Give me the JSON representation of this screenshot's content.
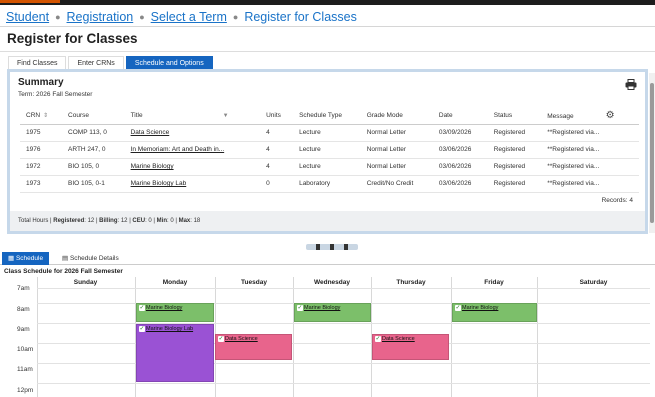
{
  "breadcrumb": {
    "student": "Student",
    "registration": "Registration",
    "select_term": "Select a Term",
    "current": "Register for Classes"
  },
  "page_title": "Register for Classes",
  "tabs": [
    "Find Classes",
    "Enter CRNs",
    "Schedule and Options"
  ],
  "summary": {
    "title": "Summary",
    "term": "Term:  2026 Fall Semester",
    "columns": [
      "CRN",
      "Course",
      "Title",
      "Units",
      "Schedule Type",
      "Grade Mode",
      "Date",
      "Status",
      "Message"
    ],
    "rows": [
      [
        "1975",
        "COMP 113, 0",
        "Data Science",
        "4",
        "Lecture",
        "Normal Letter",
        "03/09/2026",
        "Registered",
        "**Registered via..."
      ],
      [
        "1976",
        "ARTH 247, 0",
        "In Memoriam: Art and Death in...",
        "4",
        "Lecture",
        "Normal Letter",
        "03/06/2026",
        "Registered",
        "**Registered via..."
      ],
      [
        "1972",
        "BIO 105, 0",
        "Marine Biology",
        "4",
        "Lecture",
        "Normal Letter",
        "03/06/2026",
        "Registered",
        "**Registered via..."
      ],
      [
        "1973",
        "BIO 105, 0-1",
        "Marine Biology Lab",
        "0",
        "Laboratory",
        "Credit/No Credit",
        "03/06/2026",
        "Registered",
        "**Registered via..."
      ]
    ],
    "records": "Records: 4",
    "footer": {
      "hours_label": "Total Hours | ",
      "registered_label": "Registered",
      "registered": ": 12 | ",
      "billing_label": "Billing",
      "billing": ": 12 | ",
      "ceu_label": "CEU",
      "ceu": ": 0 | ",
      "min_label": "Min",
      "min": ": 0 | ",
      "max_label": "Max",
      "max": ": 18"
    }
  },
  "bottom_tabs": [
    "Schedule",
    "Schedule Details"
  ],
  "schedule": {
    "title": "Class Schedule for 2026 Fall Semester",
    "days": [
      "Sunday",
      "Monday",
      "Tuesday",
      "Wednesday",
      "Thursday",
      "Friday",
      "Saturday"
    ],
    "times": [
      "7am",
      "8am",
      "9am",
      "10am",
      "11am",
      "12pm"
    ],
    "events": [
      {
        "label": "Marine Biology",
        "color": "#7cbf6a"
      },
      {
        "label": "Marine Biology",
        "color": "#7cbf6a"
      },
      {
        "label": "Marine Biology",
        "color": "#7cbf6a"
      },
      {
        "label": "Marine Biology Lab",
        "color": "#9a52d4"
      },
      {
        "label": "Data Science",
        "color": "#e8648c"
      },
      {
        "label": "Data Science",
        "color": "#e8648c"
      }
    ]
  }
}
